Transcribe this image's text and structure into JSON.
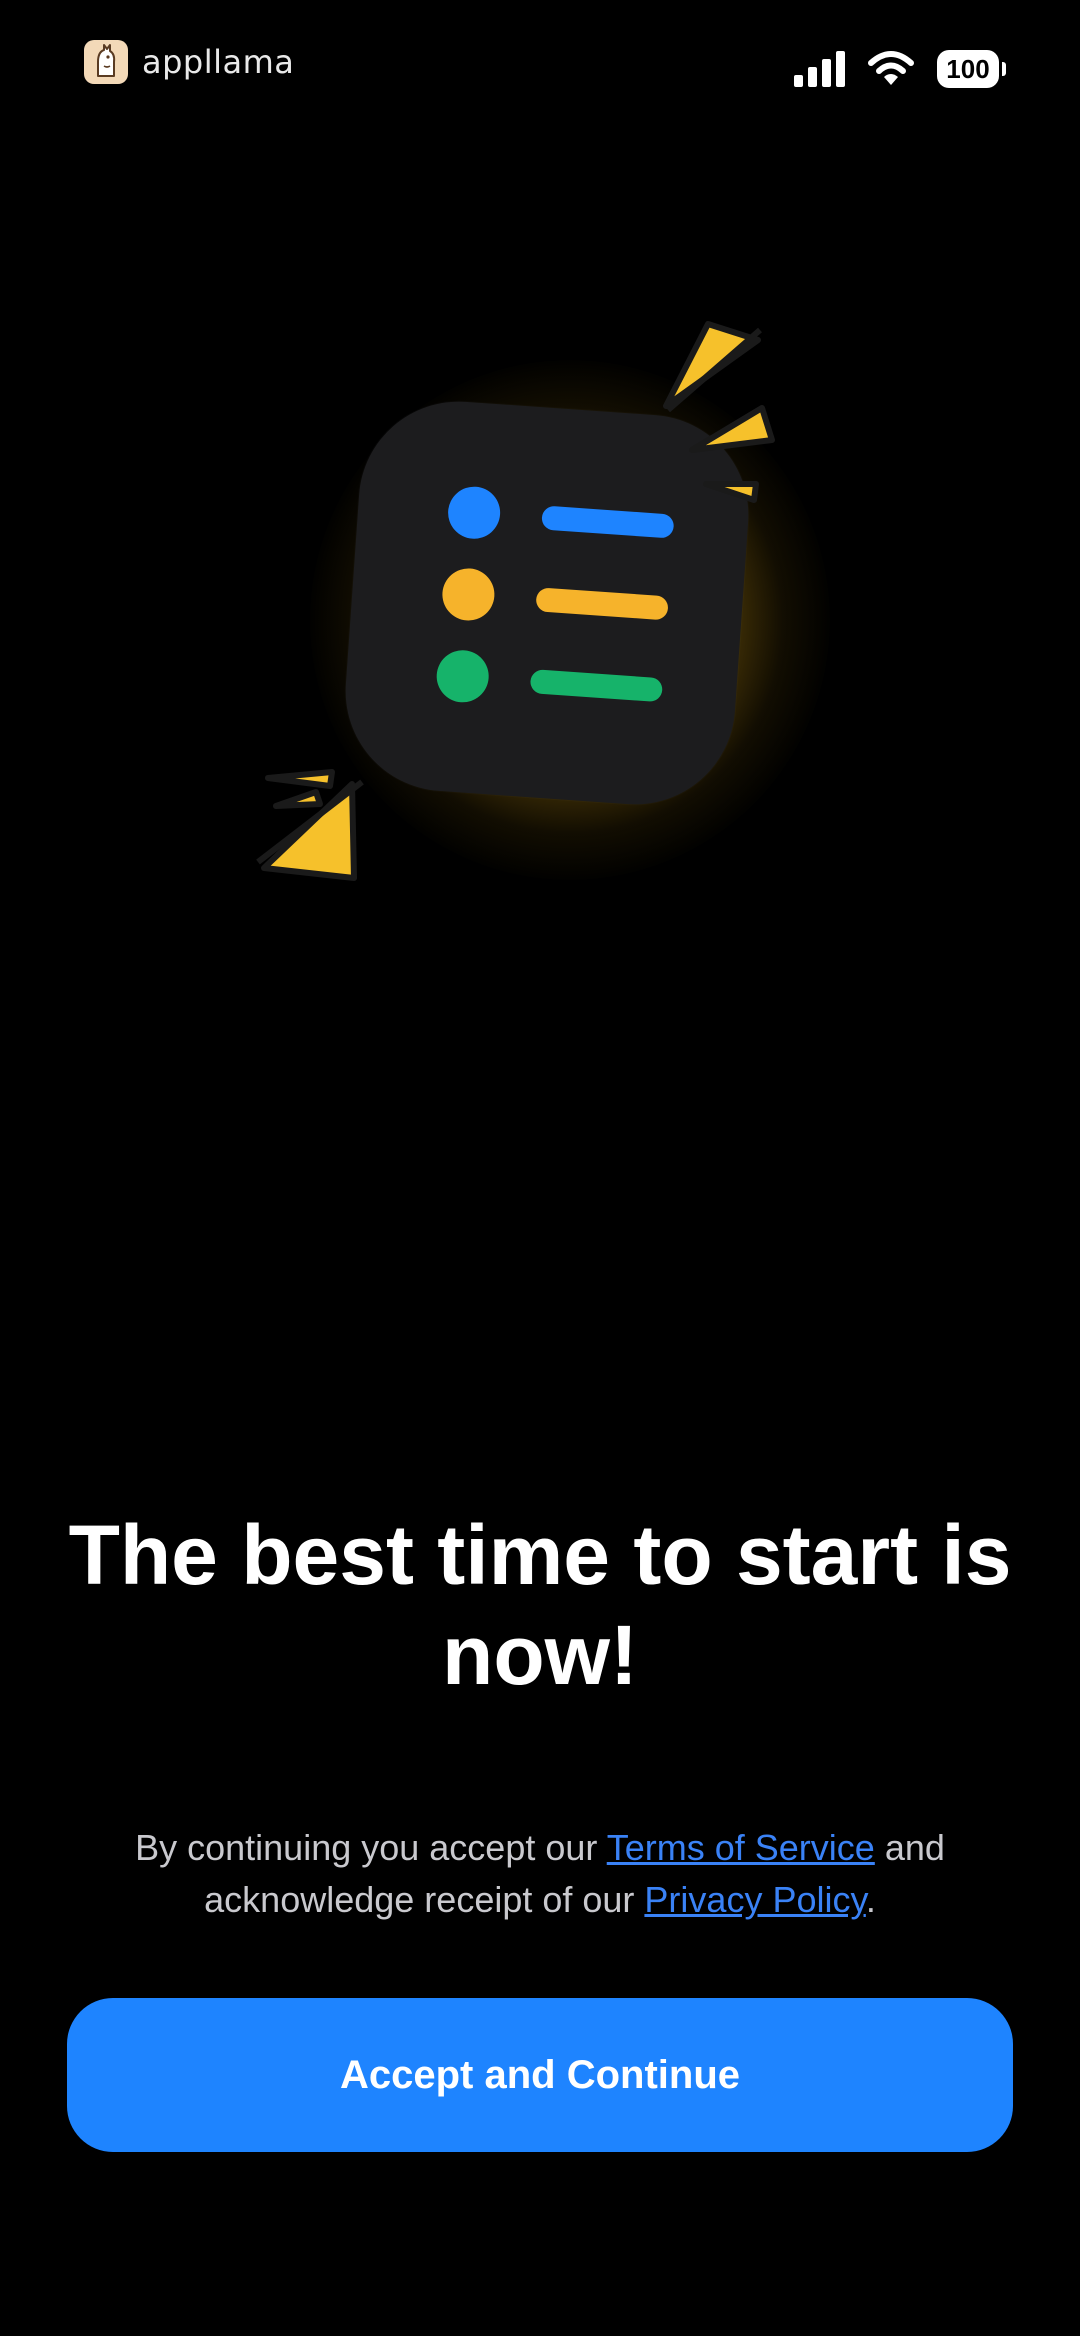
{
  "status_bar": {
    "brand_name": "appllama",
    "battery_level": "100",
    "signal_bars": 4,
    "wifi": true
  },
  "illustration": {
    "icon": "checklist-icon",
    "rows": [
      {
        "dot_color": "#1e84ff",
        "bar_color": "#1e84ff"
      },
      {
        "dot_color": "#f6b32b",
        "bar_color": "#f6b32b"
      },
      {
        "dot_color": "#16b36a",
        "bar_color": "#16b36a"
      }
    ],
    "accent_color": "#f6c12b"
  },
  "onboarding": {
    "headline": "The best time to start is now!",
    "legal_prefix": "By continuing you accept our ",
    "terms_link": "Terms of Service",
    "legal_middle": " and acknowledge receipt of our ",
    "privacy_link": "Privacy Policy",
    "legal_suffix": ".",
    "accept_button_label": "Accept and Continue"
  },
  "colors": {
    "background": "#000000",
    "primary_button": "#1e84ff",
    "link": "#3a82f6"
  }
}
